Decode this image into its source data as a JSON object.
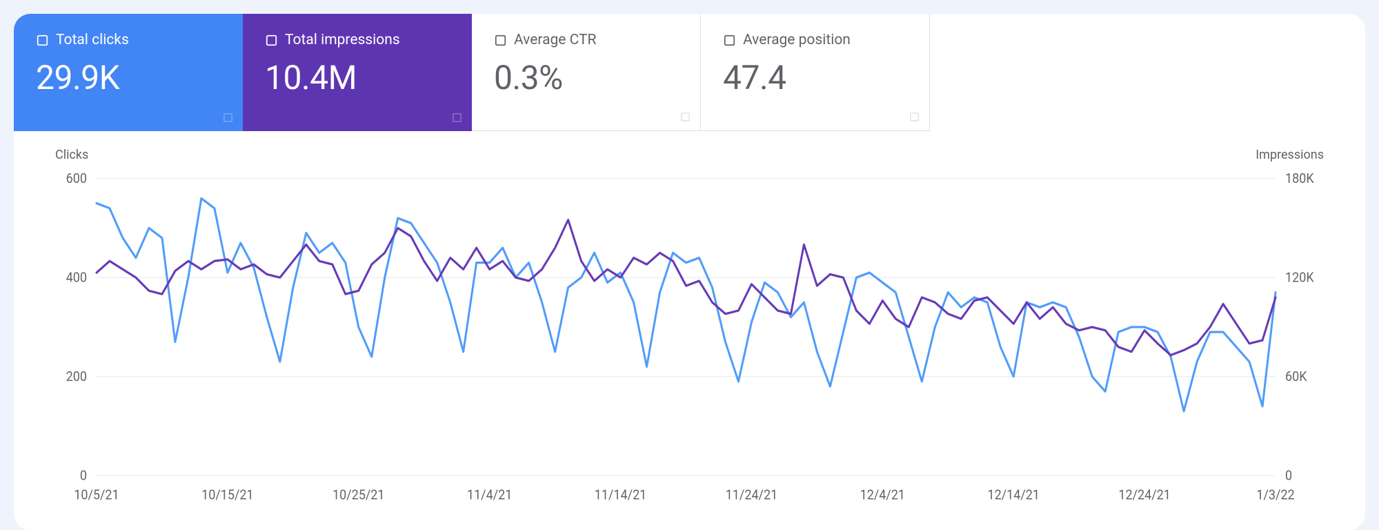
{
  "metrics": {
    "clicks": {
      "label": "Total clicks",
      "value": "29.9K"
    },
    "impressions": {
      "label": "Total impressions",
      "value": "10.4M"
    },
    "ctr": {
      "label": "Average CTR",
      "value": "0.3%"
    },
    "position": {
      "label": "Average position",
      "value": "47.4"
    }
  },
  "chart": {
    "left_axis_title": "Clicks",
    "right_axis_title": "Impressions"
  },
  "colors": {
    "blue": "#4285f4",
    "purple": "#5e35b1",
    "line_blue": "#4f9cf9",
    "line_purple": "#673ab7",
    "grid": "#e8eaed",
    "text_muted": "#5f6368"
  },
  "chart_data": {
    "type": "line",
    "xlabel": "",
    "ylabel_left": "Clicks",
    "ylabel_right": "Impressions",
    "ylim_left": [
      0,
      600
    ],
    "ylim_right": [
      0,
      180000
    ],
    "left_ticks": [
      0,
      200,
      400,
      600
    ],
    "right_ticks": [
      "0",
      "60K",
      "120K",
      "180K"
    ],
    "x_ticks": [
      "10/5/21",
      "10/15/21",
      "10/25/21",
      "11/4/21",
      "11/14/21",
      "11/24/21",
      "12/4/21",
      "12/14/21",
      "12/24/21",
      "1/3/22"
    ],
    "categories": [
      "10/5/21",
      "10/6/21",
      "10/7/21",
      "10/8/21",
      "10/9/21",
      "10/10/21",
      "10/11/21",
      "10/12/21",
      "10/13/21",
      "10/14/21",
      "10/15/21",
      "10/16/21",
      "10/17/21",
      "10/18/21",
      "10/19/21",
      "10/20/21",
      "10/21/21",
      "10/22/21",
      "10/23/21",
      "10/24/21",
      "10/25/21",
      "10/26/21",
      "10/27/21",
      "10/28/21",
      "10/29/21",
      "10/30/21",
      "10/31/21",
      "11/1/21",
      "11/2/21",
      "11/3/21",
      "11/4/21",
      "11/5/21",
      "11/6/21",
      "11/7/21",
      "11/8/21",
      "11/9/21",
      "11/10/21",
      "11/11/21",
      "11/12/21",
      "11/13/21",
      "11/14/21",
      "11/15/21",
      "11/16/21",
      "11/17/21",
      "11/18/21",
      "11/19/21",
      "11/20/21",
      "11/21/21",
      "11/22/21",
      "11/23/21",
      "11/24/21",
      "11/25/21",
      "11/26/21",
      "11/27/21",
      "11/28/21",
      "11/29/21",
      "11/30/21",
      "12/1/21",
      "12/2/21",
      "12/3/21",
      "12/4/21",
      "12/5/21",
      "12/6/21",
      "12/7/21",
      "12/8/21",
      "12/9/21",
      "12/10/21",
      "12/11/21",
      "12/12/21",
      "12/13/21",
      "12/14/21",
      "12/15/21",
      "12/16/21",
      "12/17/21",
      "12/18/21",
      "12/19/21",
      "12/20/21",
      "12/21/21",
      "12/22/21",
      "12/23/21",
      "12/24/21",
      "12/25/21",
      "12/26/21",
      "12/27/21",
      "12/28/21",
      "12/29/21",
      "12/30/21",
      "12/31/21",
      "1/1/22",
      "1/2/22",
      "1/3/22"
    ],
    "series": [
      {
        "name": "Clicks",
        "axis": "left",
        "color": "#4f9cf9",
        "values": [
          550,
          540,
          480,
          440,
          500,
          480,
          270,
          400,
          560,
          540,
          410,
          470,
          420,
          320,
          230,
          380,
          490,
          450,
          470,
          430,
          300,
          240,
          400,
          520,
          510,
          470,
          430,
          350,
          250,
          430,
          430,
          460,
          400,
          430,
          350,
          250,
          380,
          400,
          450,
          390,
          410,
          350,
          220,
          370,
          450,
          430,
          440,
          380,
          270,
          190,
          310,
          390,
          370,
          320,
          350,
          250,
          180,
          290,
          400,
          410,
          390,
          370,
          280,
          190,
          300,
          370,
          340,
          360,
          350,
          260,
          200,
          350,
          340,
          350,
          340,
          280,
          200,
          170,
          290,
          300,
          300,
          290,
          240,
          130,
          230,
          290,
          290,
          260,
          230,
          140,
          370
        ]
      },
      {
        "name": "Impressions",
        "axis": "right",
        "color": "#673ab7",
        "values": [
          123000,
          130000,
          125000,
          120000,
          112000,
          110000,
          124000,
          130000,
          125000,
          130000,
          131000,
          125000,
          128000,
          122000,
          120000,
          130000,
          140000,
          130000,
          128000,
          110000,
          112000,
          128000,
          135000,
          150000,
          145000,
          130000,
          118000,
          132000,
          125000,
          138000,
          125000,
          130000,
          120000,
          118000,
          125000,
          138000,
          155000,
          130000,
          118000,
          125000,
          120000,
          132000,
          128000,
          135000,
          130000,
          115000,
          118000,
          105000,
          98000,
          100000,
          116000,
          108000,
          100000,
          98000,
          140000,
          115000,
          122000,
          120000,
          100000,
          92000,
          106000,
          95000,
          90000,
          108000,
          105000,
          98000,
          95000,
          106000,
          108000,
          100000,
          92000,
          105000,
          95000,
          102000,
          92000,
          88000,
          90000,
          88000,
          78000,
          75000,
          88000,
          80000,
          73000,
          76000,
          80000,
          90000,
          104000,
          92000,
          80000,
          82000,
          108000
        ]
      }
    ]
  }
}
